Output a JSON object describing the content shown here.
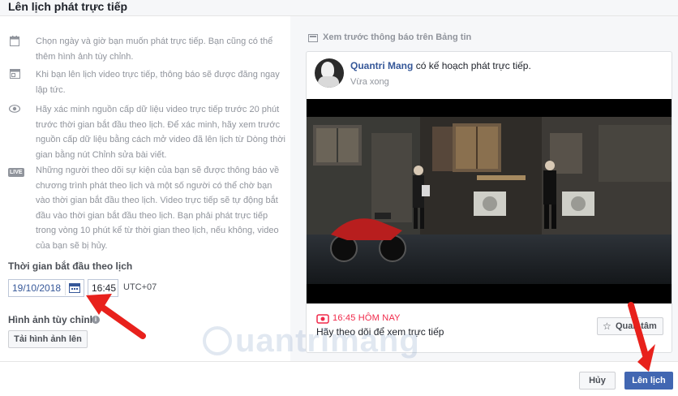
{
  "dialog": {
    "title": "Lên lịch phát trực tiếp"
  },
  "info": [
    {
      "icon": "calendar-icon",
      "text": "Chọn ngày và giờ bạn muốn phát trực tiếp. Bạn cũng có thể thêm hình ảnh tùy chỉnh."
    },
    {
      "icon": "post-icon",
      "text": "Khi bạn lên lịch video trực tiếp, thông báo sẽ được đăng ngay lập tức."
    },
    {
      "icon": "eye-icon",
      "text": "Hãy xác minh nguồn cấp dữ liệu video trực tiếp trước 20 phút trước thời gian bắt đầu theo lịch. Để xác minh, hãy xem trước nguồn cấp dữ liệu bằng cách mở video đã lên lịch từ Dòng thời gian bằng nút Chỉnh sửa bài viết."
    },
    {
      "icon": "live-icon",
      "badge": "LIVE",
      "text": "Những người theo dõi sự kiện của bạn sẽ được thông báo về chương trình phát theo lịch và một số người có thể chờ bạn vào thời gian bắt đầu theo lịch. Video trực tiếp sẽ tự động bắt đầu vào thời gian bắt đầu theo lịch. Bạn phải phát trực tiếp trong vòng 10 phút kể từ thời gian theo lịch, nếu không, video của bạn sẽ bị hủy."
    }
  ],
  "schedule": {
    "label": "Thời gian bắt đầu theo lịch",
    "date": "19/10/2018",
    "time": "16:45",
    "timezone": "UTC+07"
  },
  "custom_image": {
    "label": "Hình ảnh tùy chỉnh",
    "upload_label": "Tải hình ảnh lên"
  },
  "preview": {
    "label": "Xem trước thông báo trên Bảng tin",
    "author": "Quantri Mang",
    "action": "có kế hoạch phát trực tiếp.",
    "time": "Vừa xong",
    "live_time": "16:45 HÔM NAY",
    "description": "Hãy theo dõi để xem trực tiếp",
    "interest_label": "Quan tâm"
  },
  "footer": {
    "cancel_label": "Hủy",
    "schedule_label": "Lên lịch"
  },
  "watermark": "uantrimang",
  "colors": {
    "accent": "#4267b2",
    "link": "#365899",
    "live_red": "#f02849",
    "arrow_red": "#e8211c"
  }
}
